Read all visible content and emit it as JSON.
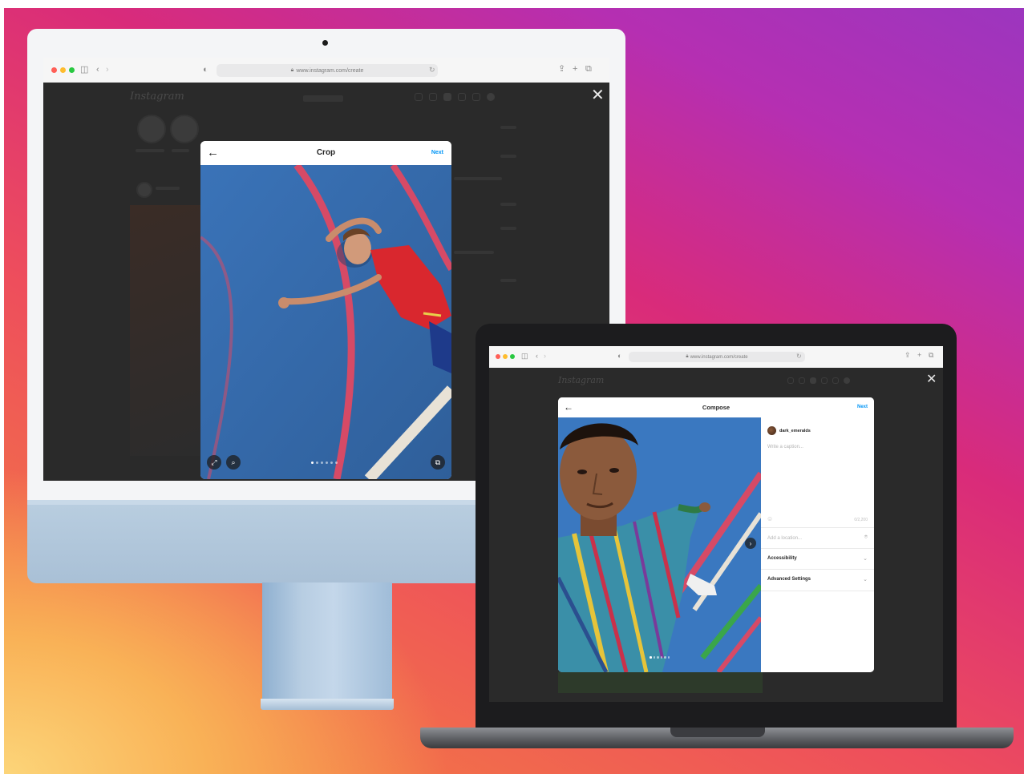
{
  "colors": {
    "instagram_blue": "#0095f6",
    "imac_blue": "#b9cee0",
    "macbook_space_gray": "#1c1c1e"
  },
  "imac": {
    "browser": {
      "url": "www.instagram.com/create"
    },
    "page": {
      "logo": "Instagram"
    },
    "modal": {
      "title": "Crop",
      "back_icon": "arrow-left-icon",
      "next_label": "Next",
      "controls": [
        "expand-icon",
        "zoom-icon",
        "multiple-images-icon"
      ],
      "pager_count": 6,
      "pager_active": 0
    }
  },
  "macbook": {
    "browser": {
      "url": "www.instagram.com/create"
    },
    "page": {
      "logo": "Instagram"
    },
    "modal": {
      "title": "Compose",
      "back_icon": "arrow-left-icon",
      "next_label": "Next",
      "username": "dark_emeralds",
      "caption_placeholder": "Write a caption...",
      "char_count": "0/2,200",
      "location_placeholder": "Add a location...",
      "accessibility_label": "Accessibility",
      "advanced_label": "Advanced Settings",
      "pager_count": 6,
      "pager_active": 0
    }
  }
}
